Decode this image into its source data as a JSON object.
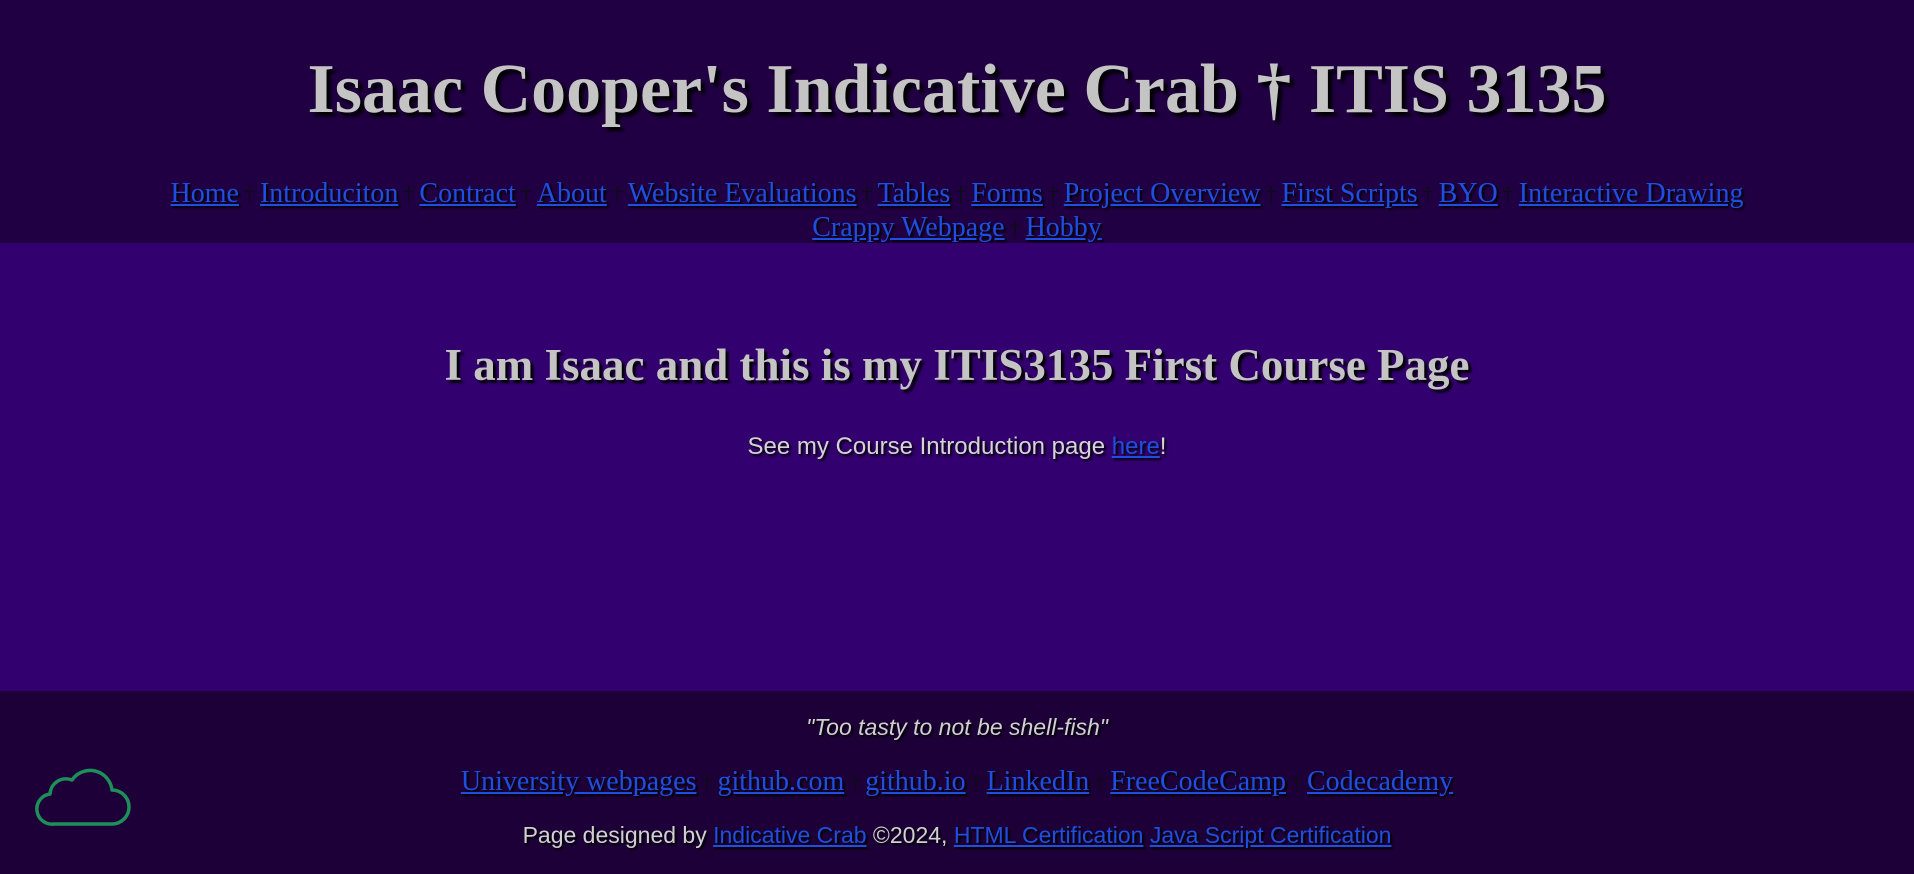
{
  "header": {
    "title": "Isaac Cooper's Indicative Crab † ITIS 3135",
    "separator": "†",
    "nav": [
      {
        "label": "Home"
      },
      {
        "label": "Introduciton"
      },
      {
        "label": "Contract"
      },
      {
        "label": "About"
      },
      {
        "label": "Website Evaluations"
      },
      {
        "label": "Tables"
      },
      {
        "label": "Forms"
      },
      {
        "label": "Project Overview"
      },
      {
        "label": "First Scripts"
      },
      {
        "label": "BYO"
      },
      {
        "label": "Interactive Drawing"
      },
      {
        "label": "Crappy Webpage"
      },
      {
        "label": "Hobby"
      }
    ]
  },
  "main": {
    "heading": "I am Isaac and this is my ITIS3135 First Course Page",
    "intro_prefix": "See my Course Introduction page ",
    "intro_link": "here",
    "intro_suffix": "!"
  },
  "footer": {
    "quote": "\"Too tasty to not be shell-fish\"",
    "separator": "†",
    "links": [
      {
        "label": "University webpages"
      },
      {
        "label": "github.com"
      },
      {
        "label": "github.io"
      },
      {
        "label": "LinkedIn"
      },
      {
        "label": "FreeCodeCamp"
      },
      {
        "label": "Codecademy"
      }
    ],
    "credits_prefix": "Page designed by ",
    "credits_brand": "Indicative Crab",
    "credits_year": " ©2024, ",
    "cert_html": "HTML Certification",
    "cert_js": "Java Script Certification"
  },
  "colors": {
    "header_bg": "#200042",
    "main_bg": "#33006f",
    "footer_bg": "#1d0038",
    "link": "#1f4fe0",
    "text": "#c4c4c4",
    "cloud_stroke": "#1f8f5a"
  },
  "icons": {
    "floating": "cloud-icon"
  }
}
